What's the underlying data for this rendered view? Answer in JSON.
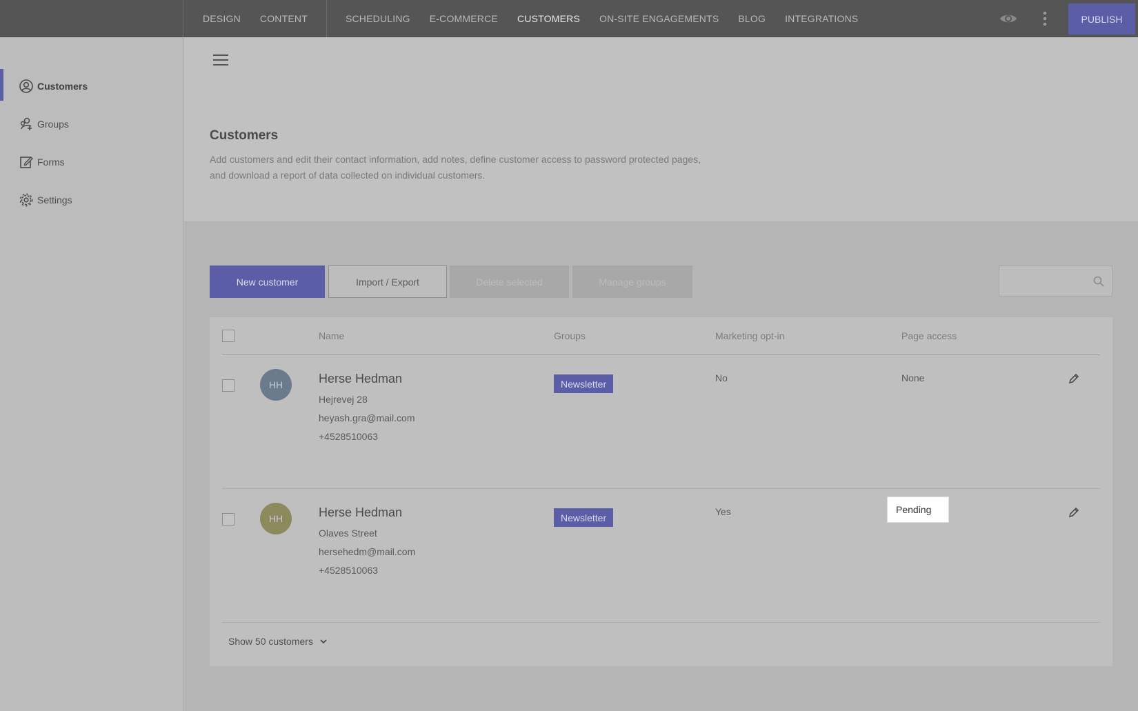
{
  "topnav": {
    "items": [
      "DESIGN",
      "CONTENT",
      "SCHEDULING",
      "E-COMMERCE",
      "CUSTOMERS",
      "ON-SITE ENGAGEMENTS",
      "BLOG",
      "INTEGRATIONS"
    ],
    "active": "CUSTOMERS",
    "publish_label": "PUBLISH"
  },
  "sidebar": {
    "items": [
      {
        "label": "Customers",
        "icon": "user-circle-icon",
        "active": true
      },
      {
        "label": "Groups",
        "icon": "group-icon",
        "active": false
      },
      {
        "label": "Forms",
        "icon": "form-edit-icon",
        "active": false
      },
      {
        "label": "Settings",
        "icon": "gear-icon",
        "active": false
      }
    ]
  },
  "header": {
    "title": "Customers",
    "description": "Add customers and edit their contact information, add notes, define customer access to password protected pages, and download a report of data collected on individual customers."
  },
  "toolbar": {
    "new_label": "New customer",
    "import_label": "Import / Export",
    "delete_label": "Delete selected",
    "groups_label": "Manage groups",
    "search_placeholder": ""
  },
  "table": {
    "columns": [
      "Name",
      "Groups",
      "Marketing opt-in",
      "Page access"
    ],
    "rows": [
      {
        "initials": "HH",
        "avatar_color": "#6b7b8c",
        "name": "Herse Hedman",
        "address": "Hejrevej 28",
        "email": "heyash.gra@mail.com",
        "phone": "+4528510063",
        "group": "Newsletter",
        "optin": "No",
        "access": "None"
      },
      {
        "initials": "HH",
        "avatar_color": "#8c8a5c",
        "name": "Herse Hedman",
        "address": "Olaves Street",
        "email": "hersehedm@mail.com",
        "phone": "+4528510063",
        "group": "Newsletter",
        "optin": "Yes",
        "access": "Pending"
      }
    ],
    "footer_label": "Show 50 customers"
  },
  "colors": {
    "accent": "#5b5ea6",
    "topbar": "#555555"
  }
}
